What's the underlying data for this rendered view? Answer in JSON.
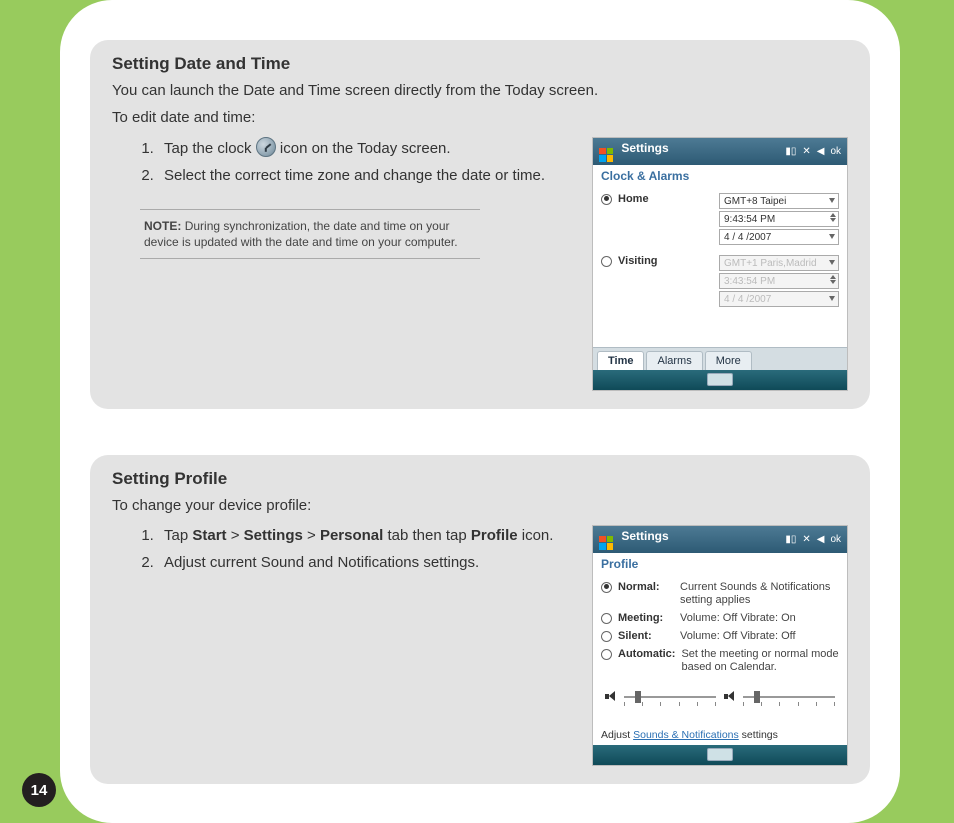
{
  "page_number": "14",
  "section1": {
    "heading": "Setting Date and Time",
    "intro1": "You can launch the Date and Time screen directly from the Today screen.",
    "intro2": "To edit date and time:",
    "step1_a": "Tap the clock ",
    "step1_b": " icon on the Today screen.",
    "step2": "Select the correct time zone and change the date or time.",
    "note_label": "NOTE:",
    "note_text": "During synchronization, the date and time on your device is updated with the date and time on your computer.",
    "shot": {
      "title": "Settings",
      "sys_ok": "ok",
      "subhead": "Clock & Alarms",
      "home_label": "Home",
      "visiting_label": "Visiting",
      "home_tz": "GMT+8 Taipei",
      "home_time": "9:43:54 PM",
      "home_date": "4 / 4 /2007",
      "visit_tz": "GMT+1 Paris,Madrid",
      "visit_time": "3:43:54 PM",
      "visit_date": "4 / 4 /2007",
      "tab_time": "Time",
      "tab_alarms": "Alarms",
      "tab_more": "More"
    }
  },
  "section2": {
    "heading": "Setting Profile",
    "intro": "To change your device profile:",
    "step1_a": "Tap ",
    "step1_b": "Start",
    "step1_c": " > ",
    "step1_d": "Settings",
    "step1_e": " > ",
    "step1_f": "Personal",
    "step1_g": " tab then tap ",
    "step1_h": "Profile",
    "step1_i": " icon.",
    "step2": "Adjust current Sound and Notifications settings.",
    "shot": {
      "title": "Settings",
      "sys_ok": "ok",
      "subhead": "Profile",
      "opt_normal": "Normal:",
      "opt_normal_desc": "Current Sounds & Notifications setting applies",
      "opt_meeting": "Meeting:",
      "opt_meeting_desc": "Volume: Off Vibrate: On",
      "opt_silent": "Silent:",
      "opt_silent_desc": "Volume: Off Vibrate: Off",
      "opt_auto": "Automatic:",
      "opt_auto_desc": "Set the meeting or normal mode based on Calendar.",
      "adjust_a": "Adjust ",
      "adjust_link": "Sounds & Notifications",
      "adjust_b": " settings"
    }
  }
}
